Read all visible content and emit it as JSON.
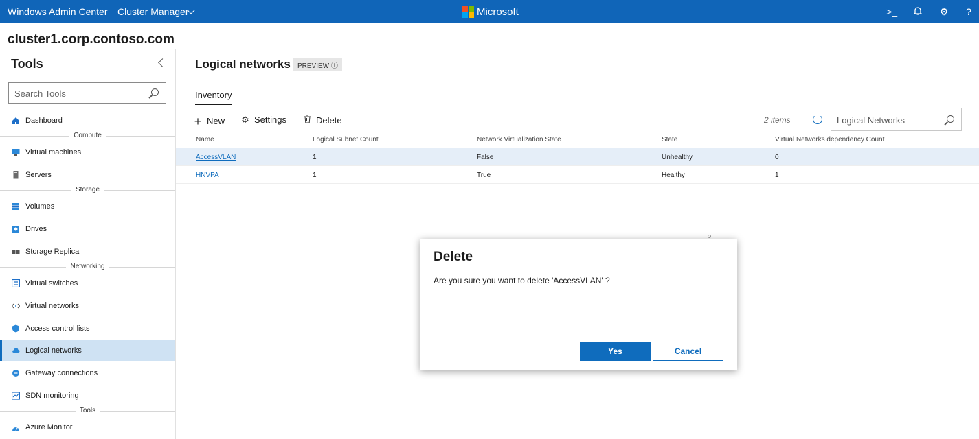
{
  "header": {
    "app_name": "Windows Admin Center",
    "context": "Cluster Manager",
    "brand": "Microsoft"
  },
  "cluster_name": "cluster1.corp.contoso.com",
  "sidebar": {
    "title": "Tools",
    "search_placeholder": "Search Tools",
    "items": [
      {
        "label": "Dashboard"
      },
      {
        "section": "Compute"
      },
      {
        "label": "Virtual machines"
      },
      {
        "label": "Servers"
      },
      {
        "section": "Storage"
      },
      {
        "label": "Volumes"
      },
      {
        "label": "Drives"
      },
      {
        "label": "Storage Replica"
      },
      {
        "section": "Networking"
      },
      {
        "label": "Virtual switches"
      },
      {
        "label": "Virtual networks"
      },
      {
        "label": "Access control lists"
      },
      {
        "label": "Logical networks"
      },
      {
        "label": "Gateway connections"
      },
      {
        "label": "SDN monitoring"
      },
      {
        "section": "Tools"
      },
      {
        "label": "Azure Monitor"
      }
    ]
  },
  "main": {
    "title": "Logical networks",
    "badge": "PREVIEW",
    "tab": "Inventory",
    "toolbar": {
      "new": "New",
      "settings": "Settings",
      "delete": "Delete"
    },
    "item_count": "2 items",
    "search_placeholder": "Logical Networks",
    "columns": [
      "Name",
      "Logical Subnet Count",
      "Network Virtualization State",
      "State",
      "Virtual Networks dependency Count"
    ],
    "rows": [
      [
        "AccessVLAN",
        "1",
        "False",
        "Unhealthy",
        "0"
      ],
      [
        "HNVPA",
        "1",
        "True",
        "Healthy",
        "1"
      ]
    ]
  },
  "dialog": {
    "title": "Delete",
    "message": "Are you sure you want to delete 'AccessVLAN' ?",
    "yes": "Yes",
    "cancel": "Cancel"
  }
}
